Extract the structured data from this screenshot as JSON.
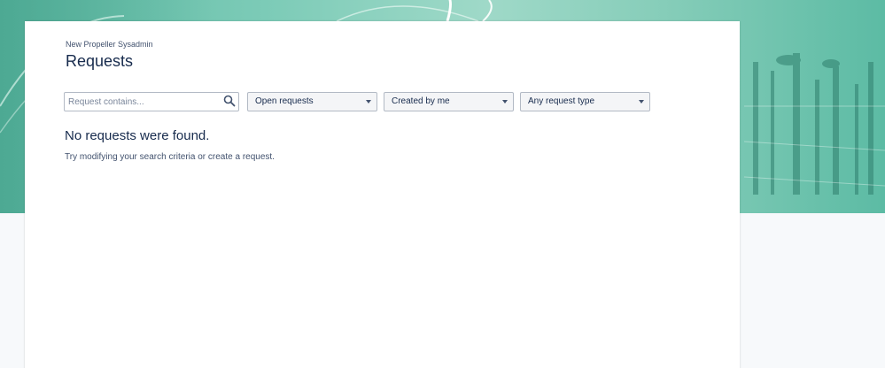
{
  "colors": {
    "banner_green": "#7ccbb7",
    "text_primary": "#172b4d",
    "text_secondary": "#42526e",
    "border": "#b3bac5",
    "select_bg": "#f4f5f7"
  },
  "header": {
    "breadcrumb": "New Propeller Sysadmin",
    "title": "Requests"
  },
  "filters": {
    "search": {
      "placeholder": "Request contains...",
      "value": "",
      "icon": "search-icon"
    },
    "status": {
      "selected": "Open requests",
      "icon": "chevron-down-icon"
    },
    "owner": {
      "selected": "Created by me",
      "icon": "chevron-down-icon"
    },
    "type": {
      "selected": "Any request type",
      "icon": "chevron-down-icon"
    }
  },
  "empty_state": {
    "title": "No requests were found.",
    "hint_prefix": "Try modifying your search criteria or ",
    "hint_link": "create a request",
    "hint_suffix": "."
  }
}
